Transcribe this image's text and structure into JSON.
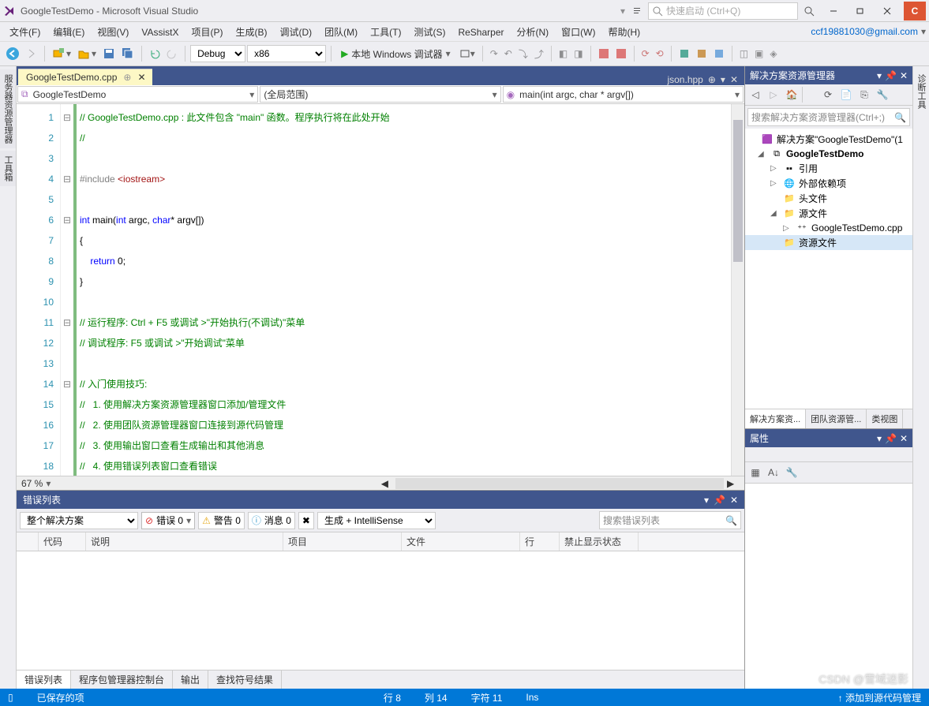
{
  "title": "GoogleTestDemo - Microsoft Visual Studio",
  "quicklaunch": "快速启动 (Ctrl+Q)",
  "menus": [
    "文件(F)",
    "编辑(E)",
    "视图(V)",
    "VAssistX",
    "项目(P)",
    "生成(B)",
    "调试(D)",
    "团队(M)",
    "工具(T)",
    "测试(S)",
    "ReSharper",
    "分析(N)",
    "窗口(W)",
    "帮助(H)"
  ],
  "email": "ccf19881030@gmail.com",
  "toolbar": {
    "config": "Debug",
    "platform": "x86",
    "debugger": "本地 Windows 调试器"
  },
  "left_tabs": [
    "服务器资源管理器",
    "工具箱"
  ],
  "right_tab": "诊断工具",
  "doc_tabs": {
    "active": "GoogleTestDemo.cpp",
    "inactive": "json.hpp"
  },
  "nav": {
    "scope": "GoogleTestDemo",
    "global": "(全局范围)",
    "func": "main(int argc, char * argv[])"
  },
  "code": [
    {
      "n": 1,
      "t": "comment",
      "s": "// GoogleTestDemo.cpp : 此文件包含 \"main\" 函数。程序执行将在此处开始"
    },
    {
      "n": 2,
      "t": "comment",
      "s": "//"
    },
    {
      "n": 3,
      "t": "plain",
      "s": ""
    },
    {
      "n": 4,
      "t": "include",
      "s": "#include <iostream>"
    },
    {
      "n": 5,
      "t": "plain",
      "s": ""
    },
    {
      "n": 6,
      "t": "sig",
      "s": "int main(int argc, char* argv[])"
    },
    {
      "n": 7,
      "t": "plain",
      "s": "{"
    },
    {
      "n": 8,
      "t": "ret",
      "s": "    return 0;"
    },
    {
      "n": 9,
      "t": "plain",
      "s": "}"
    },
    {
      "n": 10,
      "t": "plain",
      "s": ""
    },
    {
      "n": 11,
      "t": "comment",
      "s": "// 运行程序: Ctrl + F5 或调试 >\"开始执行(不调试)\"菜单"
    },
    {
      "n": 12,
      "t": "comment",
      "s": "// 调试程序: F5 或调试 >\"开始调试\"菜单"
    },
    {
      "n": 13,
      "t": "plain",
      "s": ""
    },
    {
      "n": 14,
      "t": "comment",
      "s": "// 入门使用技巧:"
    },
    {
      "n": 15,
      "t": "comment",
      "s": "//   1. 使用解决方案资源管理器窗口添加/管理文件"
    },
    {
      "n": 16,
      "t": "comment",
      "s": "//   2. 使用团队资源管理器窗口连接到源代码管理"
    },
    {
      "n": 17,
      "t": "comment",
      "s": "//   3. 使用输出窗口查看生成输出和其他消息"
    },
    {
      "n": 18,
      "t": "comment",
      "s": "//   4. 使用错误列表窗口查看错误"
    }
  ],
  "zoom": "67 %",
  "errors": {
    "title": "错误列表",
    "scope": "整个解决方案",
    "err": "错误 0",
    "warn": "警告 0",
    "msg": "消息 0",
    "filter": "生成 + IntelliSense",
    "search": "搜索错误列表",
    "cols": [
      "",
      "代码",
      "说明",
      "项目",
      "文件",
      "行",
      "禁止显示状态"
    ],
    "tabs": [
      "错误列表",
      "程序包管理器控制台",
      "输出",
      "查找符号结果"
    ]
  },
  "sln": {
    "title": "解决方案资源管理器",
    "search": "搜索解决方案资源管理器(Ctrl+;)",
    "root": "解决方案\"GoogleTestDemo\"(1",
    "project": "GoogleTestDemo",
    "nodes": {
      "refs": "引用",
      "ext": "外部依赖项",
      "hdr": "头文件",
      "src": "源文件",
      "srcfile": "GoogleTestDemo.cpp",
      "res": "资源文件"
    },
    "btabs": [
      "解决方案资...",
      "团队资源管...",
      "类视图"
    ]
  },
  "props": {
    "title": "属性"
  },
  "status": {
    "saved": "已保存的项",
    "line": "行 8",
    "col": "列 14",
    "char": "字符 11",
    "ins": "Ins",
    "add": "↑ 添加到源代码管理"
  },
  "watermark": "CSDN @雪域迷影"
}
